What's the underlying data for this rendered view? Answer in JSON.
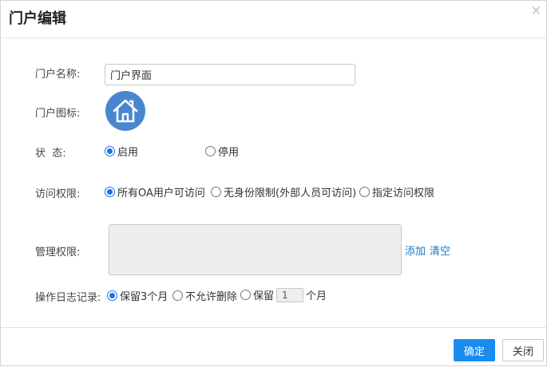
{
  "dialog": {
    "title": "门户编辑",
    "close_glyph": "×"
  },
  "form": {
    "name_label": "门户名称:",
    "name_value": "门户界面",
    "icon_label": "门户图标:",
    "icon_name": "house-icon",
    "status_label": "状  态:",
    "status_options": [
      "启用",
      "停用"
    ],
    "status_selected": "启用",
    "access_label": "访问权限:",
    "access_options": [
      "所有OA用户可访问",
      "无身份限制(外部人员可访问)",
      "指定访问权限"
    ],
    "access_selected": "所有OA用户可访问",
    "admin_label": "管理权限:",
    "admin_add": "添加",
    "admin_clear": "清空",
    "log_label": "操作日志记录:",
    "log_options": [
      "保留3个月",
      "不允许删除",
      "保留"
    ],
    "log_selected": "保留3个月",
    "log_months_value": "1",
    "log_months_unit": "个月"
  },
  "footer": {
    "ok_label": "确定",
    "close_label": "关闭"
  },
  "colors": {
    "accent": "#1a8cf0",
    "icon_bg": "#4a86cf",
    "link": "#1a78c2"
  }
}
